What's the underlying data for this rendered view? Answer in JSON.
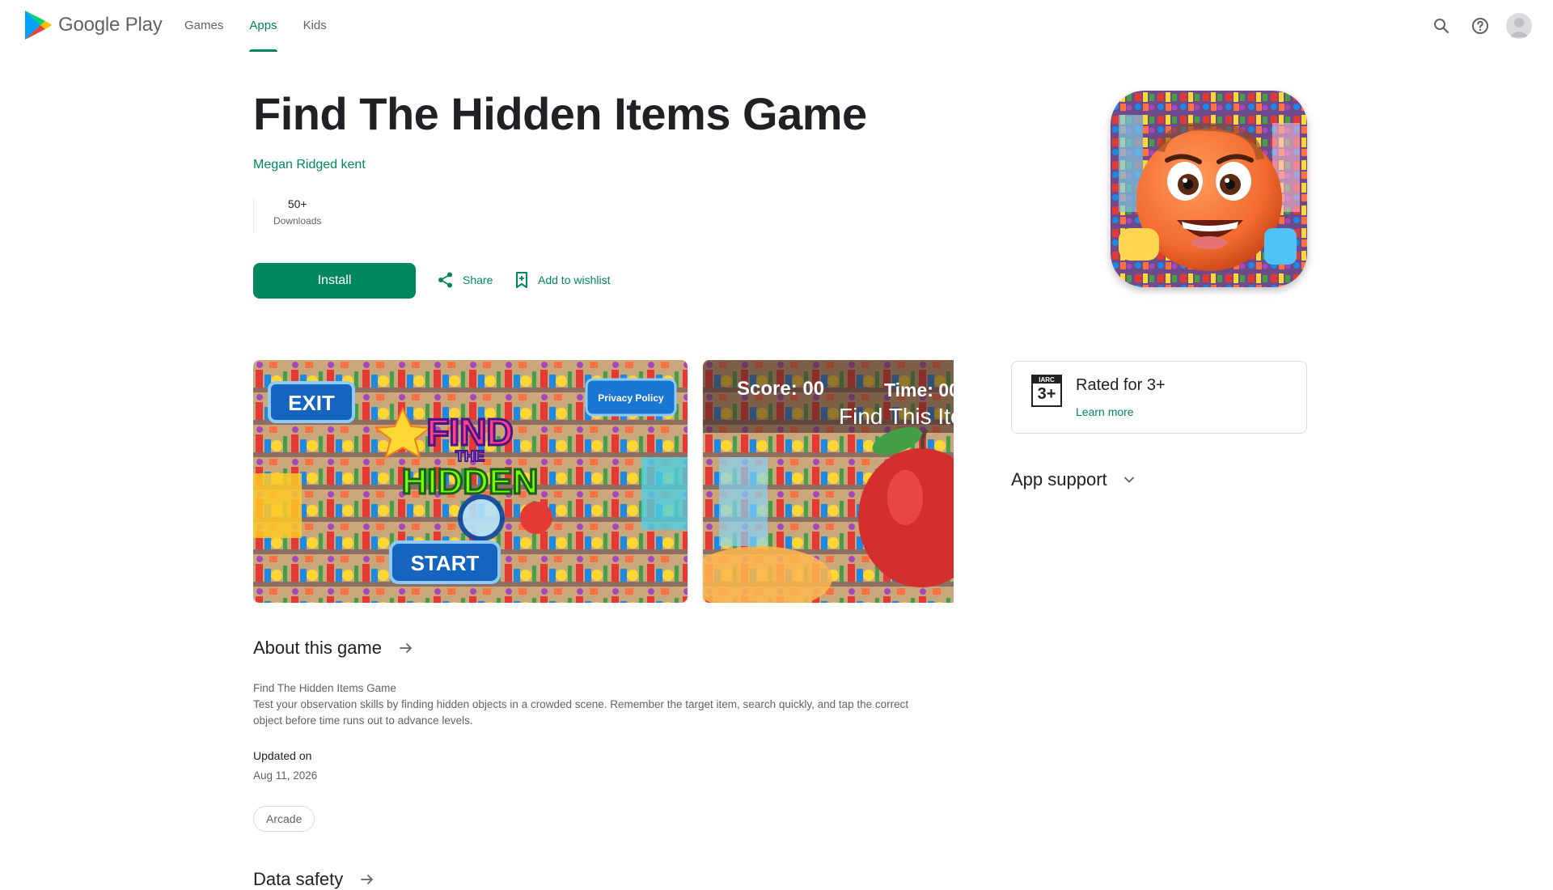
{
  "header": {
    "logo_text": "Google Play",
    "nav": [
      {
        "label": "Games",
        "active": false
      },
      {
        "label": "Apps",
        "active": true
      },
      {
        "label": "Kids",
        "active": false
      }
    ],
    "icons": [
      "search-icon",
      "help-icon",
      "account-avatar"
    ]
  },
  "app": {
    "title": "Find The Hidden Items Game",
    "developer": "Megan Ridged kent",
    "downloads_value": "50+",
    "downloads_label": "Downloads",
    "install_label": "Install",
    "share_label": "Share",
    "wishlist_label": "Add to wishlist"
  },
  "screenshots": {
    "shot1": {
      "exit": "EXIT",
      "privacy": "Privacy Policy",
      "find": "FIND",
      "the": "THE",
      "hidden": "HIDDEN",
      "start": "START"
    },
    "shot2": {
      "score": "Score: 00",
      "time": "Time: 00",
      "find_item": "Find This Ite"
    }
  },
  "rating": {
    "badge_top": "IARC",
    "badge_value": "3+",
    "text": "Rated for 3+",
    "learn_more": "Learn more"
  },
  "app_support": "App support",
  "about": {
    "heading": "About this game",
    "line1": "Find The Hidden Items Game",
    "line2": "Test your observation skills by finding hidden objects in a crowded scene. Remember the target item, search quickly, and tap the correct object before time runs out to advance levels.",
    "updated_label": "Updated on",
    "updated_date": "Aug 11, 2026",
    "tag": "Arcade"
  },
  "data_safety": "Data safety",
  "colors": {
    "accent": "#01875f",
    "text_primary": "#202124",
    "text_secondary": "#5f6368",
    "border": "#dadce0"
  }
}
